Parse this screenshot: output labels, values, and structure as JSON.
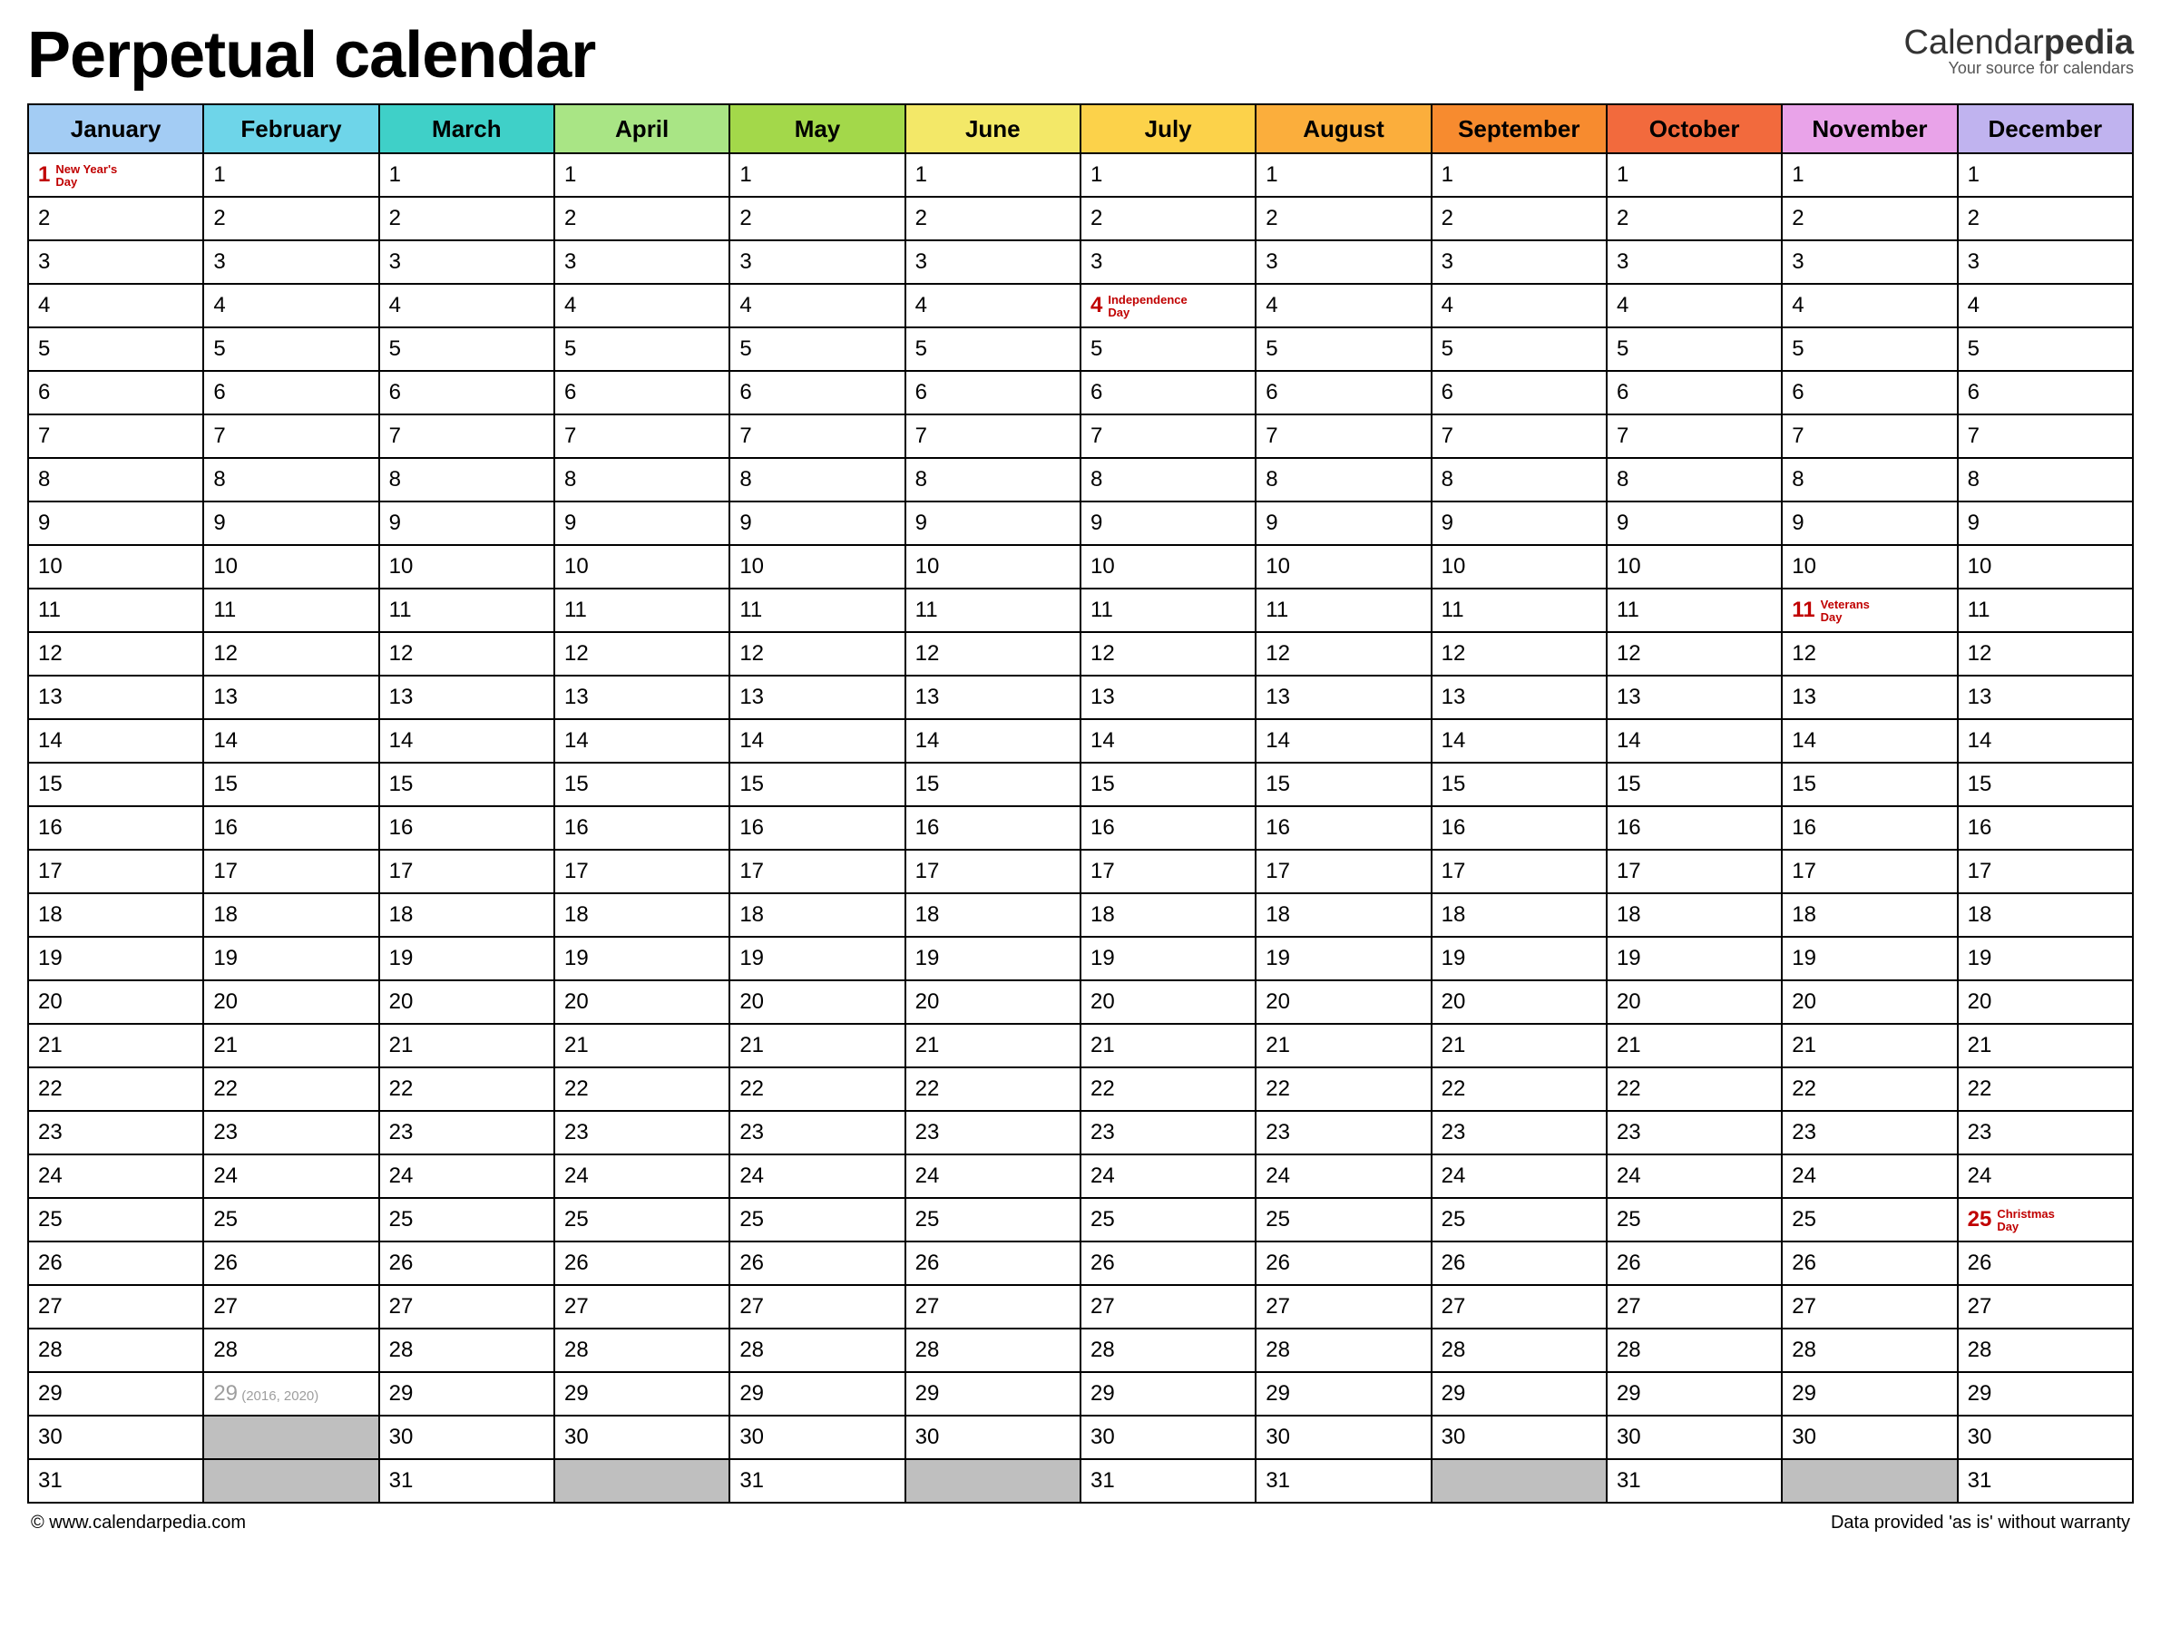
{
  "title": "Perpetual calendar",
  "brand": {
    "pre": "Calendar",
    "bold": "pedia",
    "tagline": "Your source for calendars"
  },
  "months": [
    {
      "name": "January",
      "color": "#a3ccf4",
      "days": 31
    },
    {
      "name": "February",
      "color": "#6ed5e9",
      "days": 29
    },
    {
      "name": "March",
      "color": "#3fd0c8",
      "days": 31
    },
    {
      "name": "April",
      "color": "#a9e585",
      "days": 30
    },
    {
      "name": "May",
      "color": "#a3d84a",
      "days": 31
    },
    {
      "name": "June",
      "color": "#f3e868",
      "days": 30
    },
    {
      "name": "July",
      "color": "#fcd24a",
      "days": 31
    },
    {
      "name": "August",
      "color": "#fbae3c",
      "days": 31
    },
    {
      "name": "September",
      "color": "#f78b2f",
      "days": 30
    },
    {
      "name": "October",
      "color": "#f26a3d",
      "days": 31
    },
    {
      "name": "November",
      "color": "#e9a3e9",
      "days": 30
    },
    {
      "name": "December",
      "color": "#c0b3ef",
      "days": 31
    }
  ],
  "max_day": 31,
  "holidays": [
    {
      "month": 0,
      "day": 1,
      "label": "New Year's Day"
    },
    {
      "month": 6,
      "day": 4,
      "label": "Independence Day"
    },
    {
      "month": 10,
      "day": 11,
      "label": "Veterans Day"
    },
    {
      "month": 11,
      "day": 25,
      "label": "Christmas Day"
    }
  ],
  "leap": {
    "month": 1,
    "day": 29,
    "years": "(2016, 2020)"
  },
  "footer": {
    "left": "© www.calendarpedia.com",
    "right": "Data provided 'as is' without warranty"
  }
}
